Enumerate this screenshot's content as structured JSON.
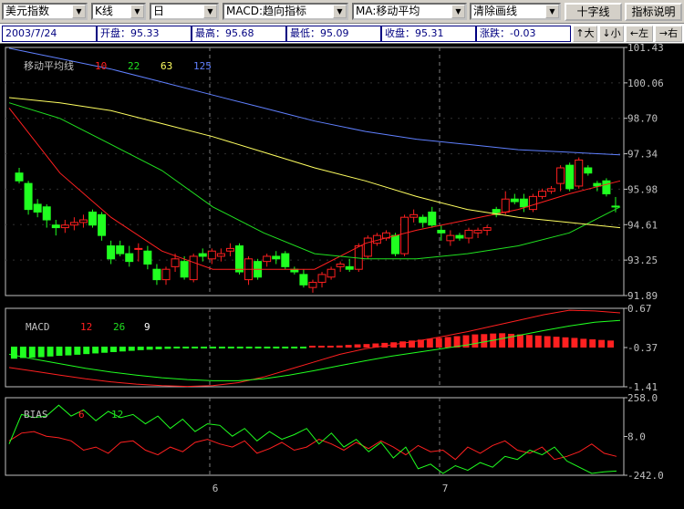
{
  "toolbar": {
    "index_select": "美元指数",
    "type_select": "K线",
    "period_select": "日",
    "macd_select": "MACD:趋向指标",
    "ma_select": "MA:移动平均",
    "clear_select": "清除画线",
    "crosshair_button": "十字线",
    "help_button": "指标说明"
  },
  "infobar": {
    "date": "2003/7/24",
    "open": "开盘：95.33",
    "high": "最高：95.68",
    "low": "最低：95.09",
    "close": "收盘：95.31",
    "change": "涨跌：-0.03",
    "nav_up": "↑大",
    "nav_down": "↓小",
    "nav_left": "←左",
    "nav_right": "→右"
  },
  "colors": {
    "background": "#000000",
    "up": "#ff2020",
    "down": "#20ff20",
    "ma10": "#ff2020",
    "ma22": "#20e020",
    "ma63": "#ffff60",
    "ma125": "#6080ff",
    "axis": "#c0c0c0",
    "grid": "#808080"
  },
  "chart_data": [
    {
      "type": "candlestick",
      "title": "移动平均线",
      "legend": [
        {
          "name": "10",
          "color": "#ff2020"
        },
        {
          "name": "22",
          "color": "#20e020"
        },
        {
          "name": "63",
          "color": "#ffff60"
        },
        {
          "name": "125",
          "color": "#6080ff"
        }
      ],
      "ylim": [
        91.89,
        101.43
      ],
      "yticks": [
        "101.43",
        "100.06",
        "98.70",
        "97.34",
        "95.98",
        "94.61",
        "93.25",
        "91.89"
      ],
      "xticks": [
        "6",
        "7"
      ],
      "candles": [
        {
          "o": 96.6,
          "h": 96.8,
          "l": 96.2,
          "c": 96.3
        },
        {
          "o": 96.2,
          "h": 96.3,
          "l": 95.0,
          "c": 95.2
        },
        {
          "o": 95.4,
          "h": 95.6,
          "l": 94.9,
          "c": 95.1
        },
        {
          "o": 95.3,
          "h": 95.4,
          "l": 94.5,
          "c": 94.8
        },
        {
          "o": 94.6,
          "h": 94.8,
          "l": 94.2,
          "c": 94.5
        },
        {
          "o": 94.5,
          "h": 94.8,
          "l": 94.3,
          "c": 94.6
        },
        {
          "o": 94.6,
          "h": 94.9,
          "l": 94.4,
          "c": 94.7
        },
        {
          "o": 94.7,
          "h": 95.0,
          "l": 94.5,
          "c": 94.8
        },
        {
          "o": 95.1,
          "h": 95.2,
          "l": 94.5,
          "c": 94.6
        },
        {
          "o": 95.0,
          "h": 95.1,
          "l": 94.0,
          "c": 94.2
        },
        {
          "o": 93.8,
          "h": 94.0,
          "l": 93.1,
          "c": 93.3
        },
        {
          "o": 93.8,
          "h": 94.0,
          "l": 93.4,
          "c": 93.5
        },
        {
          "o": 93.5,
          "h": 93.8,
          "l": 93.0,
          "c": 93.2
        },
        {
          "o": 93.7,
          "h": 93.9,
          "l": 93.2,
          "c": 93.7
        },
        {
          "o": 93.6,
          "h": 93.8,
          "l": 92.9,
          "c": 93.1
        },
        {
          "o": 92.9,
          "h": 93.1,
          "l": 92.3,
          "c": 92.5
        },
        {
          "o": 92.5,
          "h": 93.0,
          "l": 92.3,
          "c": 92.9
        },
        {
          "o": 93.0,
          "h": 93.5,
          "l": 92.8,
          "c": 93.3
        },
        {
          "o": 93.2,
          "h": 93.4,
          "l": 92.5,
          "c": 92.6
        },
        {
          "o": 92.5,
          "h": 93.5,
          "l": 92.4,
          "c": 93.4
        },
        {
          "o": 93.5,
          "h": 93.7,
          "l": 93.2,
          "c": 93.4
        },
        {
          "o": 93.3,
          "h": 93.7,
          "l": 93.1,
          "c": 93.6
        },
        {
          "o": 93.4,
          "h": 93.7,
          "l": 93.2,
          "c": 93.5
        },
        {
          "o": 93.6,
          "h": 93.9,
          "l": 93.4,
          "c": 93.7
        },
        {
          "o": 93.8,
          "h": 93.9,
          "l": 92.7,
          "c": 92.8
        },
        {
          "o": 92.5,
          "h": 93.4,
          "l": 92.3,
          "c": 93.3
        },
        {
          "o": 93.2,
          "h": 93.3,
          "l": 92.5,
          "c": 92.6
        },
        {
          "o": 93.2,
          "h": 93.5,
          "l": 93.0,
          "c": 93.4
        },
        {
          "o": 93.4,
          "h": 93.6,
          "l": 93.1,
          "c": 93.3
        },
        {
          "o": 93.5,
          "h": 93.6,
          "l": 92.9,
          "c": 93.0
        },
        {
          "o": 92.9,
          "h": 93.0,
          "l": 92.7,
          "c": 92.8
        },
        {
          "o": 92.7,
          "h": 92.9,
          "l": 92.2,
          "c": 92.3
        },
        {
          "o": 92.2,
          "h": 92.5,
          "l": 92.0,
          "c": 92.4
        },
        {
          "o": 92.4,
          "h": 92.8,
          "l": 92.2,
          "c": 92.7
        },
        {
          "o": 92.6,
          "h": 93.0,
          "l": 92.5,
          "c": 92.9
        },
        {
          "o": 93.0,
          "h": 93.2,
          "l": 92.8,
          "c": 93.1
        },
        {
          "o": 93.0,
          "h": 93.3,
          "l": 92.8,
          "c": 92.9
        },
        {
          "o": 92.9,
          "h": 93.9,
          "l": 92.8,
          "c": 93.8
        },
        {
          "o": 93.4,
          "h": 94.2,
          "l": 93.3,
          "c": 94.1
        },
        {
          "o": 93.9,
          "h": 94.3,
          "l": 93.8,
          "c": 94.2
        },
        {
          "o": 94.1,
          "h": 94.4,
          "l": 94.0,
          "c": 94.3
        },
        {
          "o": 94.2,
          "h": 94.3,
          "l": 93.4,
          "c": 93.5
        },
        {
          "o": 93.5,
          "h": 95.0,
          "l": 93.4,
          "c": 94.9
        },
        {
          "o": 94.9,
          "h": 95.2,
          "l": 94.7,
          "c": 95.0
        },
        {
          "o": 94.9,
          "h": 95.0,
          "l": 94.5,
          "c": 94.7
        },
        {
          "o": 95.1,
          "h": 95.3,
          "l": 94.5,
          "c": 94.6
        },
        {
          "o": 94.4,
          "h": 94.6,
          "l": 94.0,
          "c": 94.3
        },
        {
          "o": 94.0,
          "h": 94.4,
          "l": 93.8,
          "c": 94.2
        },
        {
          "o": 94.2,
          "h": 94.3,
          "l": 94.0,
          "c": 94.1
        },
        {
          "o": 94.1,
          "h": 94.5,
          "l": 93.9,
          "c": 94.4
        },
        {
          "o": 94.3,
          "h": 94.5,
          "l": 94.1,
          "c": 94.4
        },
        {
          "o": 94.4,
          "h": 94.6,
          "l": 94.2,
          "c": 94.5
        },
        {
          "o": 95.2,
          "h": 95.3,
          "l": 94.9,
          "c": 95.0
        },
        {
          "o": 95.1,
          "h": 95.9,
          "l": 95.0,
          "c": 95.6
        },
        {
          "o": 95.6,
          "h": 95.8,
          "l": 95.4,
          "c": 95.5
        },
        {
          "o": 95.6,
          "h": 95.8,
          "l": 95.1,
          "c": 95.3
        },
        {
          "o": 95.2,
          "h": 95.8,
          "l": 95.1,
          "c": 95.7
        },
        {
          "o": 95.7,
          "h": 96.0,
          "l": 95.6,
          "c": 95.9
        },
        {
          "o": 95.9,
          "h": 96.1,
          "l": 95.8,
          "c": 96.0
        },
        {
          "o": 96.2,
          "h": 96.9,
          "l": 95.9,
          "c": 96.8
        },
        {
          "o": 96.9,
          "h": 97.0,
          "l": 95.9,
          "c": 96.0
        },
        {
          "o": 96.1,
          "h": 97.2,
          "l": 96.0,
          "c": 97.1
        },
        {
          "o": 96.8,
          "h": 96.9,
          "l": 96.5,
          "c": 96.6
        },
        {
          "o": 96.2,
          "h": 96.3,
          "l": 95.9,
          "c": 96.1
        },
        {
          "o": 96.3,
          "h": 96.4,
          "l": 95.7,
          "c": 95.8
        },
        {
          "o": 95.33,
          "h": 95.68,
          "l": 95.09,
          "c": 95.31
        }
      ],
      "ma_lines": [
        {
          "name": "10",
          "color": "#ff2020",
          "values": [
            99.1,
            96.6,
            94.9,
            93.6,
            92.9,
            92.9,
            92.9,
            93.9,
            94.4,
            94.8,
            95.2,
            95.8,
            96.3
          ]
        },
        {
          "name": "22",
          "color": "#20e020",
          "values": [
            99.3,
            98.7,
            97.7,
            96.7,
            95.3,
            94.3,
            93.5,
            93.3,
            93.3,
            93.5,
            93.8,
            94.3,
            95.3
          ]
        },
        {
          "name": "63",
          "color": "#ffff60",
          "values": [
            99.5,
            99.3,
            99.0,
            98.5,
            98.0,
            97.4,
            96.8,
            96.3,
            95.7,
            95.2,
            94.9,
            94.7,
            94.5
          ]
        },
        {
          "name": "125",
          "color": "#6080ff",
          "values": [
            101.4,
            101.0,
            100.6,
            100.1,
            99.6,
            99.1,
            98.6,
            98.2,
            97.9,
            97.7,
            97.5,
            97.4,
            97.3
          ]
        }
      ]
    },
    {
      "type": "bar",
      "title": "MACD",
      "legend": [
        {
          "name": "12",
          "color": "#ff2020"
        },
        {
          "name": "26",
          "color": "#20e020"
        },
        {
          "name": "9",
          "color": "#ffffff"
        }
      ],
      "ylim": [
        -1.41,
        0.67
      ],
      "yticks": [
        "0.67",
        "-0.37",
        "-1.41"
      ],
      "histogram": [
        -0.55,
        -0.52,
        -0.5,
        -0.48,
        -0.45,
        -0.42,
        -0.4,
        -0.37,
        -0.34,
        -0.31,
        -0.28,
        -0.25,
        -0.22,
        -0.19,
        -0.16,
        -0.14,
        -0.12,
        -0.1,
        -0.08,
        -0.07,
        -0.06,
        -0.05,
        -0.04,
        -0.03,
        -0.02,
        -0.01,
        -0.02,
        -0.03,
        -0.02,
        -0.01,
        -0.02,
        -0.03,
        -0.04,
        -0.05,
        -0.06,
        -0.05,
        -0.07,
        -0.09,
        -0.11,
        -0.12,
        -0.14,
        -0.16,
        -0.18,
        -0.21,
        -0.24,
        -0.27,
        -0.3,
        -0.33,
        -0.36,
        -0.39,
        -0.42,
        -0.45,
        -0.46,
        -0.48,
        -0.49,
        -0.47,
        -0.45,
        -0.43,
        -0.41,
        -0.39,
        -0.37,
        -0.35,
        -0.33,
        -0.3,
        -0.28,
        -0.26,
        -0.24
      ],
      "dif": [
        -0.9,
        -1.0,
        -1.1,
        -1.2,
        -1.28,
        -1.34,
        -1.38,
        -1.4,
        -1.38,
        -1.3,
        -1.15,
        -0.95,
        -0.75,
        -0.55,
        -0.4,
        -0.3,
        -0.2,
        -0.08,
        0.05,
        0.2,
        0.35,
        0.5,
        0.62,
        0.6,
        0.55
      ],
      "dea": [
        -0.55,
        -0.68,
        -0.8,
        -0.92,
        -1.02,
        -1.1,
        -1.17,
        -1.22,
        -1.25,
        -1.25,
        -1.2,
        -1.1,
        -0.98,
        -0.85,
        -0.72,
        -0.6,
        -0.5,
        -0.4,
        -0.3,
        -0.18,
        -0.05,
        0.08,
        0.2,
        0.3,
        0.35
      ]
    },
    {
      "type": "line",
      "title": "BIAS",
      "legend": [
        {
          "name": "6",
          "color": "#ff2020"
        },
        {
          "name": "12",
          "color": "#20e020"
        }
      ],
      "ylim": [
        -242.0,
        258.0
      ],
      "yticks": [
        "258.0",
        "8.0",
        "-242.0"
      ],
      "bias6": [
        -20,
        30,
        40,
        10,
        0,
        -20,
        -80,
        -60,
        -100,
        -30,
        -20,
        -80,
        -110,
        -60,
        -90,
        -30,
        -10,
        -40,
        -60,
        -20,
        -100,
        -70,
        -30,
        -80,
        -60,
        -10,
        -40,
        -80,
        -30,
        -70,
        -20,
        -60,
        -110,
        -50,
        -90,
        -80,
        -140,
        -60,
        -100,
        -50,
        -20,
        -80,
        -100,
        -60,
        -140,
        -120,
        -90,
        -40,
        -100,
        -120
      ],
      "bias12": [
        -40,
        150,
        130,
        140,
        210,
        140,
        180,
        110,
        170,
        130,
        150,
        90,
        140,
        60,
        120,
        40,
        90,
        80,
        10,
        60,
        -20,
        40,
        -10,
        20,
        60,
        -40,
        30,
        -60,
        -10,
        -90,
        -30,
        -130,
        -60,
        -200,
        -170,
        -230,
        -180,
        -210,
        -160,
        -190,
        -120,
        -140,
        -80,
        -110,
        -60,
        -150,
        -190,
        -230,
        -220,
        -215
      ]
    }
  ]
}
